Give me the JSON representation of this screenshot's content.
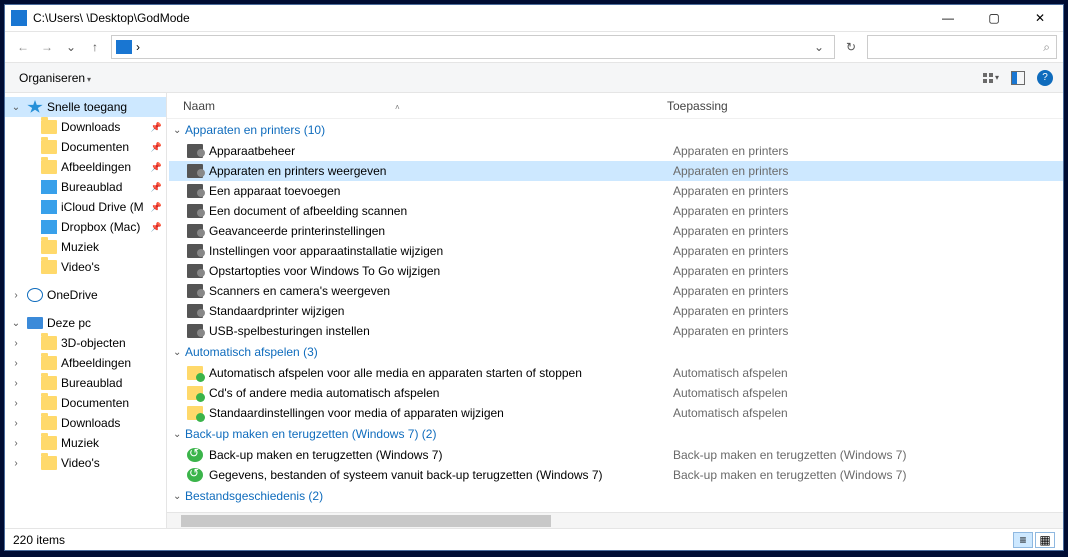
{
  "window": {
    "title": "C:\\Users\\        \\Desktop\\GodMode",
    "minimize": "—",
    "maximize": "▢",
    "close": "✕"
  },
  "nav": {
    "back": "←",
    "forward": "→",
    "up": "↑",
    "addr_icon_text": "›",
    "dropdown": "⌄",
    "refresh": "↻",
    "search_icon": "🔍"
  },
  "cmdbar": {
    "organize": "Organiseren",
    "view_drop": "▾",
    "help": "?"
  },
  "columns": {
    "name": "Naam",
    "app": "Toepassing",
    "sort": "˄"
  },
  "sidebar": {
    "quick": "Snelle toegang",
    "quick_items": [
      {
        "label": "Downloads",
        "ico": "folder",
        "pin": true
      },
      {
        "label": "Documenten",
        "ico": "folder",
        "pin": true
      },
      {
        "label": "Afbeeldingen",
        "ico": "folder",
        "pin": true
      },
      {
        "label": "Bureaublad",
        "ico": "blue",
        "pin": true
      },
      {
        "label": "iCloud Drive (M",
        "ico": "blue",
        "pin": true
      },
      {
        "label": "Dropbox (Mac)",
        "ico": "blue",
        "pin": true
      },
      {
        "label": "Muziek",
        "ico": "folder",
        "pin": false
      },
      {
        "label": "Video's",
        "ico": "folder",
        "pin": false
      }
    ],
    "onedrive": "OneDrive",
    "thispc": "Deze pc",
    "pc_items": [
      {
        "label": "3D-objecten"
      },
      {
        "label": "Afbeeldingen"
      },
      {
        "label": "Bureaublad"
      },
      {
        "label": "Documenten"
      },
      {
        "label": "Downloads"
      },
      {
        "label": "Muziek"
      },
      {
        "label": "Video's"
      }
    ]
  },
  "groups": [
    {
      "title": "Apparaten en printers (10)",
      "app": "Apparaten en printers",
      "ico": "cp",
      "items": [
        "Apparaatbeheer",
        "Apparaten en printers weergeven",
        "Een apparaat toevoegen",
        "Een document of afbeelding scannen",
        "Geavanceerde printerinstellingen",
        "Instellingen voor apparaatinstallatie wijzigen",
        "Opstartopties voor Windows To Go wijzigen",
        "Scanners en camera's weergeven",
        "Standaardprinter wijzigen",
        "USB-spelbesturingen instellen"
      ],
      "selected": 1
    },
    {
      "title": "Automatisch afspelen (3)",
      "app": "Automatisch afspelen",
      "ico": "auto",
      "items": [
        "Automatisch afspelen voor alle media en apparaten starten of stoppen",
        "Cd's of andere media automatisch afspelen",
        "Standaardinstellingen voor media of apparaten wijzigen"
      ]
    },
    {
      "title": "Back-up maken en terugzetten (Windows 7) (2)",
      "app": "Back-up maken en terugzetten (Windows 7)",
      "ico": "backup",
      "items": [
        "Back-up maken en terugzetten (Windows 7)",
        "Gegevens, bestanden of systeem vanuit back-up terugzetten (Windows 7)"
      ]
    },
    {
      "title": "Bestandsgeschiedenis (2)",
      "app": "Bestandsgeschiedenis",
      "ico": "cp",
      "items": []
    }
  ],
  "status": {
    "count": "220 items"
  }
}
